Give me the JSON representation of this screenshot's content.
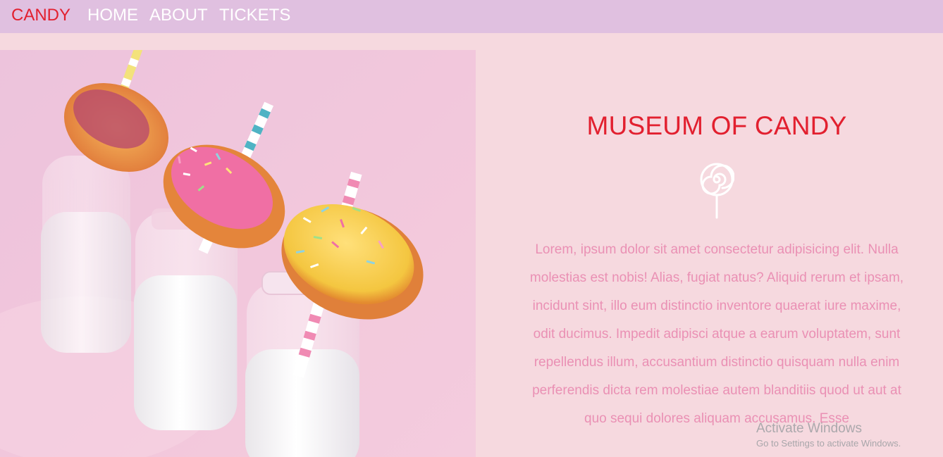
{
  "nav": {
    "brand": "CANDY",
    "links": [
      "HOME",
      "ABOUT",
      "TICKETS"
    ]
  },
  "hero": {
    "image_icon": "donuts-on-milk-bottles-photo"
  },
  "content": {
    "title": "MUSEUM OF CANDY",
    "icon": "lollipop-icon",
    "paragraph": "Lorem, ipsum dolor sit amet consectetur adipisicing elit. Nulla molestias est nobis! Alias, fugiat natus? Aliquid rerum et ipsam, incidunt sint, illo eum distinctio inventore quaerat iure maxime, odit ducimus. Impedit adipisci atque a earum voluptatem, sunt repellendus illum, accusantium distinctio quisquam nulla enim perferendis dicta rem molestiae autem blanditiis quod ut aut at quo sequi dolores aliquam accusamus. Esse"
  },
  "watermark": {
    "title": "Activate Windows",
    "subtitle": "Go to Settings to activate Windows."
  },
  "colors": {
    "navbar_bg": "#e0c0e0",
    "page_bg": "#f6d9df",
    "brand_red": "#e2202f",
    "text_pink": "#ea90b4"
  }
}
